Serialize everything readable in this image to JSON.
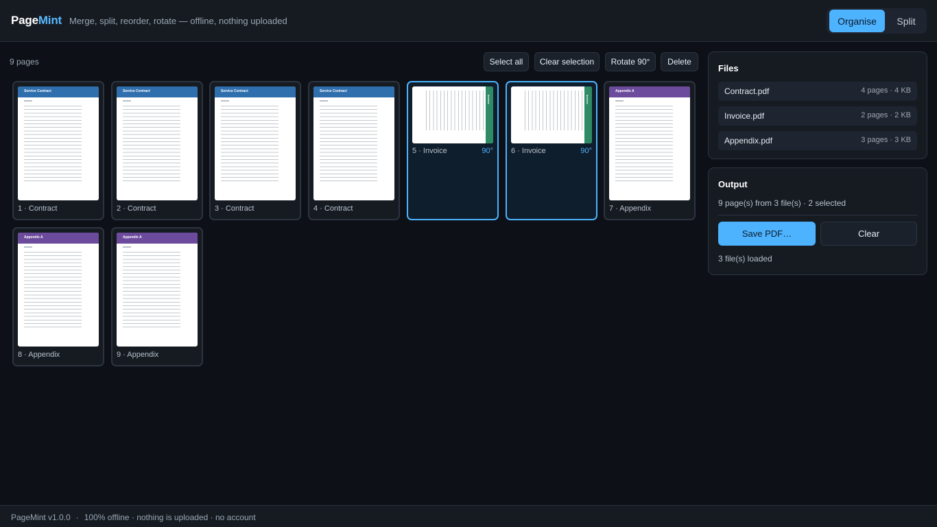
{
  "header": {
    "brand_part1": "Page",
    "brand_part2": "Mint",
    "tagline": "Merge, split, reorder, rotate — offline, nothing uploaded",
    "modes": [
      {
        "label": "Organise",
        "active": true
      },
      {
        "label": "Split",
        "active": false
      }
    ]
  },
  "toolbar": {
    "page_count": "9 pages",
    "select_all": "Select all",
    "clear_selection": "Clear selection",
    "rotate": "Rotate 90°",
    "delete": "Delete"
  },
  "pages": [
    {
      "label": "1 · Contract",
      "doc_title": "Service Contract",
      "accent": "#2f6fae",
      "selected": false,
      "rotation": ""
    },
    {
      "label": "2 · Contract",
      "doc_title": "Service Contract",
      "accent": "#2f6fae",
      "selected": false,
      "rotation": ""
    },
    {
      "label": "3 · Contract",
      "doc_title": "Service Contract",
      "accent": "#2f6fae",
      "selected": false,
      "rotation": ""
    },
    {
      "label": "4 · Contract",
      "doc_title": "Service Contract",
      "accent": "#2f6fae",
      "selected": false,
      "rotation": ""
    },
    {
      "label": "5 · Invoice",
      "doc_title": "Invoice",
      "accent": "#2f8a66",
      "selected": true,
      "rotation": "90°"
    },
    {
      "label": "6 · Invoice",
      "doc_title": "Invoice",
      "accent": "#2f8a66",
      "selected": true,
      "rotation": "90°"
    },
    {
      "label": "7 · Appendix",
      "doc_title": "Appendix A",
      "accent": "#6c4a9c",
      "selected": false,
      "rotation": ""
    },
    {
      "label": "8 · Appendix",
      "doc_title": "Appendix A",
      "accent": "#6c4a9c",
      "selected": false,
      "rotation": ""
    },
    {
      "label": "9 · Appendix",
      "doc_title": "Appendix A",
      "accent": "#6c4a9c",
      "selected": false,
      "rotation": ""
    }
  ],
  "files_panel": {
    "title": "Files",
    "files": [
      {
        "name": "Contract.pdf",
        "meta": "4 pages · 4 KB"
      },
      {
        "name": "Invoice.pdf",
        "meta": "2 pages · 2 KB"
      },
      {
        "name": "Appendix.pdf",
        "meta": "3 pages · 3 KB"
      }
    ]
  },
  "output_panel": {
    "title": "Output",
    "summary": "9 page(s) from 3 file(s) · 2 selected",
    "save_label": "Save PDF…",
    "clear_label": "Clear",
    "loaded": "3 file(s) loaded"
  },
  "footer": {
    "version": "PageMint v1.0.0",
    "separator": "·",
    "info": "100% offline · nothing is uploaded · no account"
  },
  "colors": {
    "accent": "#4db3ff",
    "contract": "#2f6fae",
    "invoice": "#2f8a66",
    "appendix": "#6c4a9c"
  }
}
